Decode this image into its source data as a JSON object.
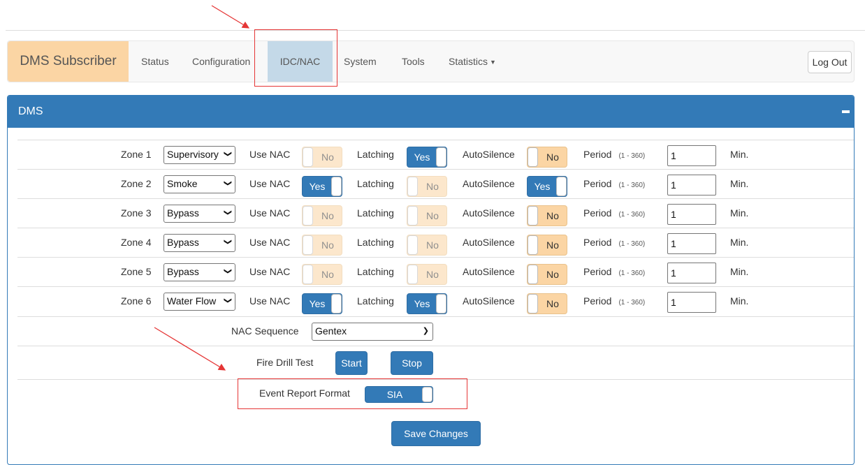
{
  "nav": {
    "brand": "DMS Subscriber",
    "items": [
      "Status",
      "Configuration",
      "IDC/NAC",
      "System",
      "Tools",
      "Statistics"
    ],
    "active": "IDC/NAC",
    "logout": "Log Out"
  },
  "panel": {
    "title": "DMS",
    "collapse_icon": "minus-icon"
  },
  "labels": {
    "use_nac": "Use NAC",
    "latching": "Latching",
    "autosilence": "AutoSilence",
    "period": "Period",
    "period_range": "(1 - 360)",
    "minutes": "Min."
  },
  "zones": [
    {
      "label": "Zone 1",
      "type": "Supervisory",
      "use_nac": "No",
      "latching": "Yes",
      "autosilence": "No",
      "period": "1"
    },
    {
      "label": "Zone 2",
      "type": "Smoke",
      "use_nac": "Yes",
      "latching": "No",
      "autosilence": "Yes",
      "period": "1"
    },
    {
      "label": "Zone 3",
      "type": "Bypass",
      "use_nac": "No",
      "latching": "No",
      "autosilence": "No",
      "period": "1"
    },
    {
      "label": "Zone 4",
      "type": "Bypass",
      "use_nac": "No",
      "latching": "No",
      "autosilence": "No",
      "period": "1"
    },
    {
      "label": "Zone 5",
      "type": "Bypass",
      "use_nac": "No",
      "latching": "No",
      "autosilence": "No",
      "period": "1"
    },
    {
      "label": "Zone 6",
      "type": "Water Flow",
      "use_nac": "Yes",
      "latching": "Yes",
      "autosilence": "No",
      "period": "1"
    }
  ],
  "nac_sequence": {
    "label": "NAC Sequence",
    "value": "Gentex"
  },
  "fire_drill": {
    "label": "Fire Drill Test",
    "start": "Start",
    "stop": "Stop"
  },
  "event_report": {
    "label": "Event Report Format",
    "value": "SIA"
  },
  "save": "Save Changes",
  "colors": {
    "primary": "#337ab7",
    "toggle_off": "#fbd5a4",
    "nav_active": "#c4d9e8",
    "annotation": "#e53535"
  }
}
